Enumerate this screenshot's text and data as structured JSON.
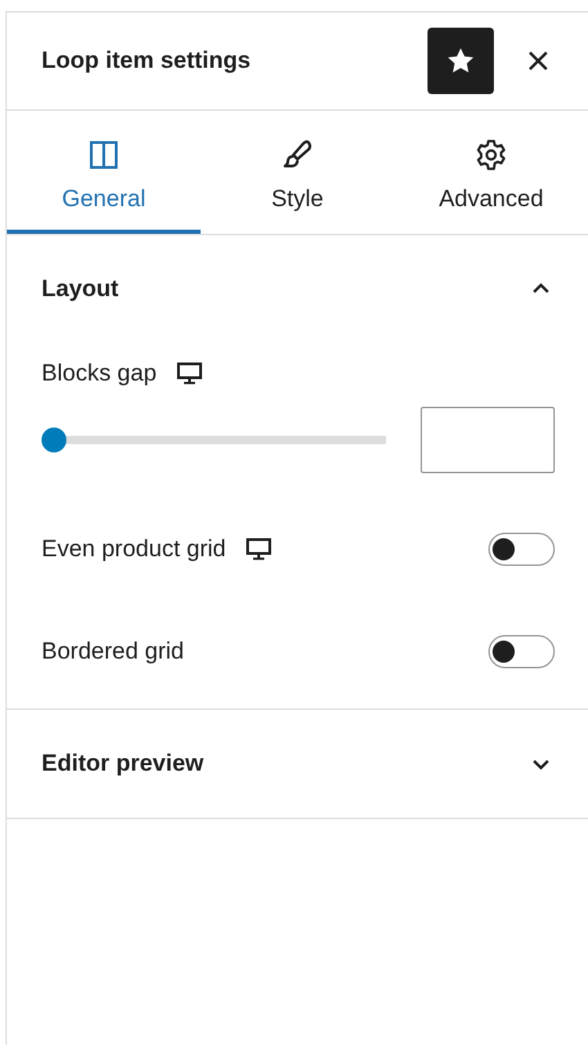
{
  "panel": {
    "title": "Loop item settings",
    "pinned": true
  },
  "tabs": [
    {
      "label": "General",
      "selected": true
    },
    {
      "label": "Style",
      "selected": false
    },
    {
      "label": "Advanced",
      "selected": false
    }
  ],
  "sections": [
    {
      "title": "Layout",
      "expanded": true,
      "controls": [
        {
          "kind": "slider",
          "label": "Blocks gap",
          "responsive": true,
          "level": 0
        },
        {
          "kind": "toggle",
          "label": "Even product grid",
          "responsive": true,
          "on": false
        },
        {
          "kind": "toggle",
          "label": "Bordered grid",
          "responsive": false,
          "on": false
        }
      ]
    },
    {
      "title": "Editor preview",
      "expanded": false
    }
  ]
}
